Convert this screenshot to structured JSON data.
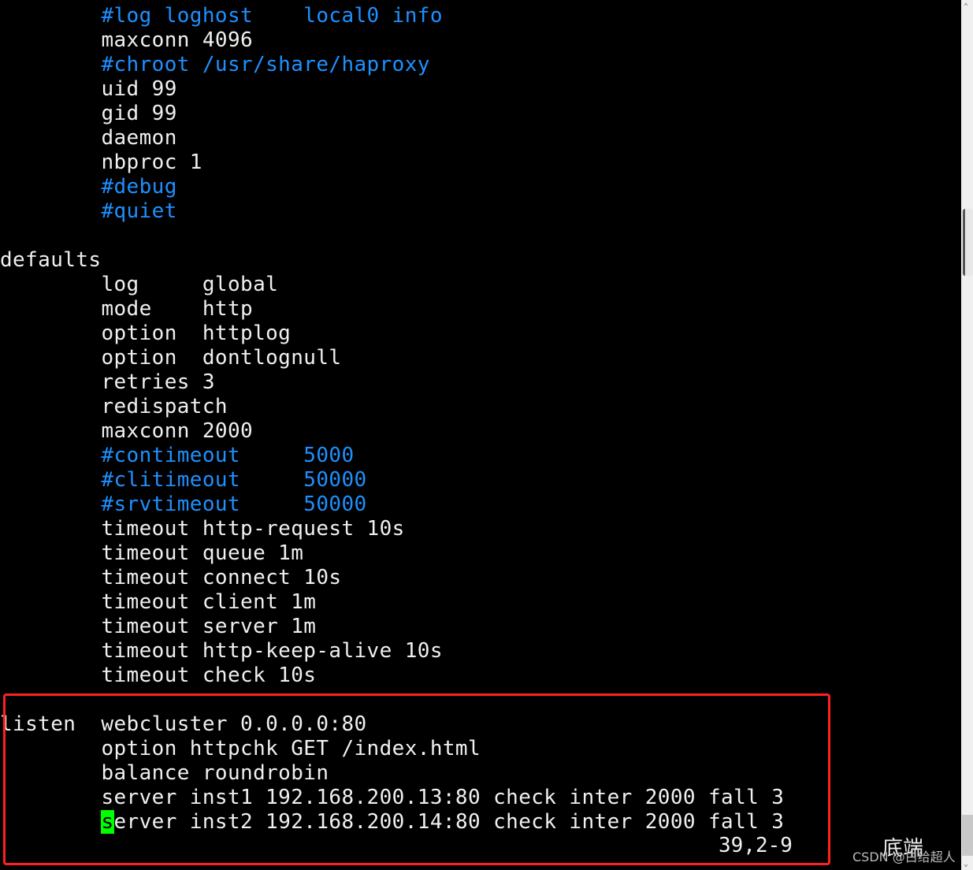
{
  "editor": {
    "lines": [
      {
        "indent": "        ",
        "segments": [
          {
            "text": "#log loghost    local0 info",
            "kind": "comment"
          }
        ]
      },
      {
        "indent": "        ",
        "segments": [
          {
            "text": "maxconn 4096",
            "kind": "normal"
          }
        ]
      },
      {
        "indent": "        ",
        "segments": [
          {
            "text": "#chroot /usr/share/haproxy",
            "kind": "comment"
          }
        ]
      },
      {
        "indent": "        ",
        "segments": [
          {
            "text": "uid 99",
            "kind": "normal"
          }
        ]
      },
      {
        "indent": "        ",
        "segments": [
          {
            "text": "gid 99",
            "kind": "normal"
          }
        ]
      },
      {
        "indent": "        ",
        "segments": [
          {
            "text": "daemon",
            "kind": "normal"
          }
        ]
      },
      {
        "indent": "        ",
        "segments": [
          {
            "text": "nbproc 1",
            "kind": "normal"
          }
        ]
      },
      {
        "indent": "        ",
        "segments": [
          {
            "text": "#debug",
            "kind": "comment"
          }
        ]
      },
      {
        "indent": "        ",
        "segments": [
          {
            "text": "#quiet",
            "kind": "comment"
          }
        ]
      },
      {
        "indent": "",
        "segments": [
          {
            "text": "",
            "kind": "normal"
          }
        ]
      },
      {
        "indent": "",
        "segments": [
          {
            "text": "defaults",
            "kind": "normal"
          }
        ]
      },
      {
        "indent": "        ",
        "segments": [
          {
            "text": "log     global",
            "kind": "normal"
          }
        ]
      },
      {
        "indent": "        ",
        "segments": [
          {
            "text": "mode    http",
            "kind": "normal"
          }
        ]
      },
      {
        "indent": "        ",
        "segments": [
          {
            "text": "option  httplog",
            "kind": "normal"
          }
        ]
      },
      {
        "indent": "        ",
        "segments": [
          {
            "text": "option  dontlognull",
            "kind": "normal"
          }
        ]
      },
      {
        "indent": "        ",
        "segments": [
          {
            "text": "retries 3",
            "kind": "normal"
          }
        ]
      },
      {
        "indent": "        ",
        "segments": [
          {
            "text": "redispatch",
            "kind": "normal"
          }
        ]
      },
      {
        "indent": "        ",
        "segments": [
          {
            "text": "maxconn 2000",
            "kind": "normal"
          }
        ]
      },
      {
        "indent": "        ",
        "segments": [
          {
            "text": "#contimeout     5000",
            "kind": "comment"
          }
        ]
      },
      {
        "indent": "        ",
        "segments": [
          {
            "text": "#clitimeout     50000",
            "kind": "comment"
          }
        ]
      },
      {
        "indent": "        ",
        "segments": [
          {
            "text": "#srvtimeout     50000",
            "kind": "comment"
          }
        ]
      },
      {
        "indent": "        ",
        "segments": [
          {
            "text": "timeout http-request 10s",
            "kind": "normal"
          }
        ]
      },
      {
        "indent": "        ",
        "segments": [
          {
            "text": "timeout queue 1m",
            "kind": "normal"
          }
        ]
      },
      {
        "indent": "        ",
        "segments": [
          {
            "text": "timeout connect 10s",
            "kind": "normal"
          }
        ]
      },
      {
        "indent": "        ",
        "segments": [
          {
            "text": "timeout client 1m",
            "kind": "normal"
          }
        ]
      },
      {
        "indent": "        ",
        "segments": [
          {
            "text": "timeout server 1m",
            "kind": "normal"
          }
        ]
      },
      {
        "indent": "        ",
        "segments": [
          {
            "text": "timeout http-keep-alive 10s",
            "kind": "normal"
          }
        ]
      },
      {
        "indent": "        ",
        "segments": [
          {
            "text": "timeout check 10s",
            "kind": "normal"
          }
        ]
      },
      {
        "indent": "",
        "segments": [
          {
            "text": "",
            "kind": "normal"
          }
        ]
      },
      {
        "indent": "",
        "segments": [
          {
            "text": "listen  webcluster 0.0.0.0:80",
            "kind": "normal"
          }
        ]
      },
      {
        "indent": "        ",
        "segments": [
          {
            "text": "option httpchk GET /index.html",
            "kind": "normal"
          }
        ]
      },
      {
        "indent": "        ",
        "segments": [
          {
            "text": "balance roundrobin",
            "kind": "normal"
          }
        ]
      },
      {
        "indent": "        ",
        "segments": [
          {
            "text": "server inst1 192.168.200.13:80 check inter 2000 fall 3",
            "kind": "normal"
          }
        ]
      },
      {
        "indent": "        ",
        "segments": [
          {
            "text": "s",
            "kind": "cursor"
          },
          {
            "text": "erver inst2 192.168.200.14:80 check inter 2000 fall 3",
            "kind": "normal"
          }
        ]
      }
    ],
    "cursor_position": "39,2-9",
    "scroll_indicator": "底端"
  },
  "watermark": "CSDN @白给超人",
  "colors": {
    "comment": "#1e90ff",
    "text": "#f0f0f0",
    "cursor": "#00ff00",
    "highlight_box": "#ff2020"
  }
}
